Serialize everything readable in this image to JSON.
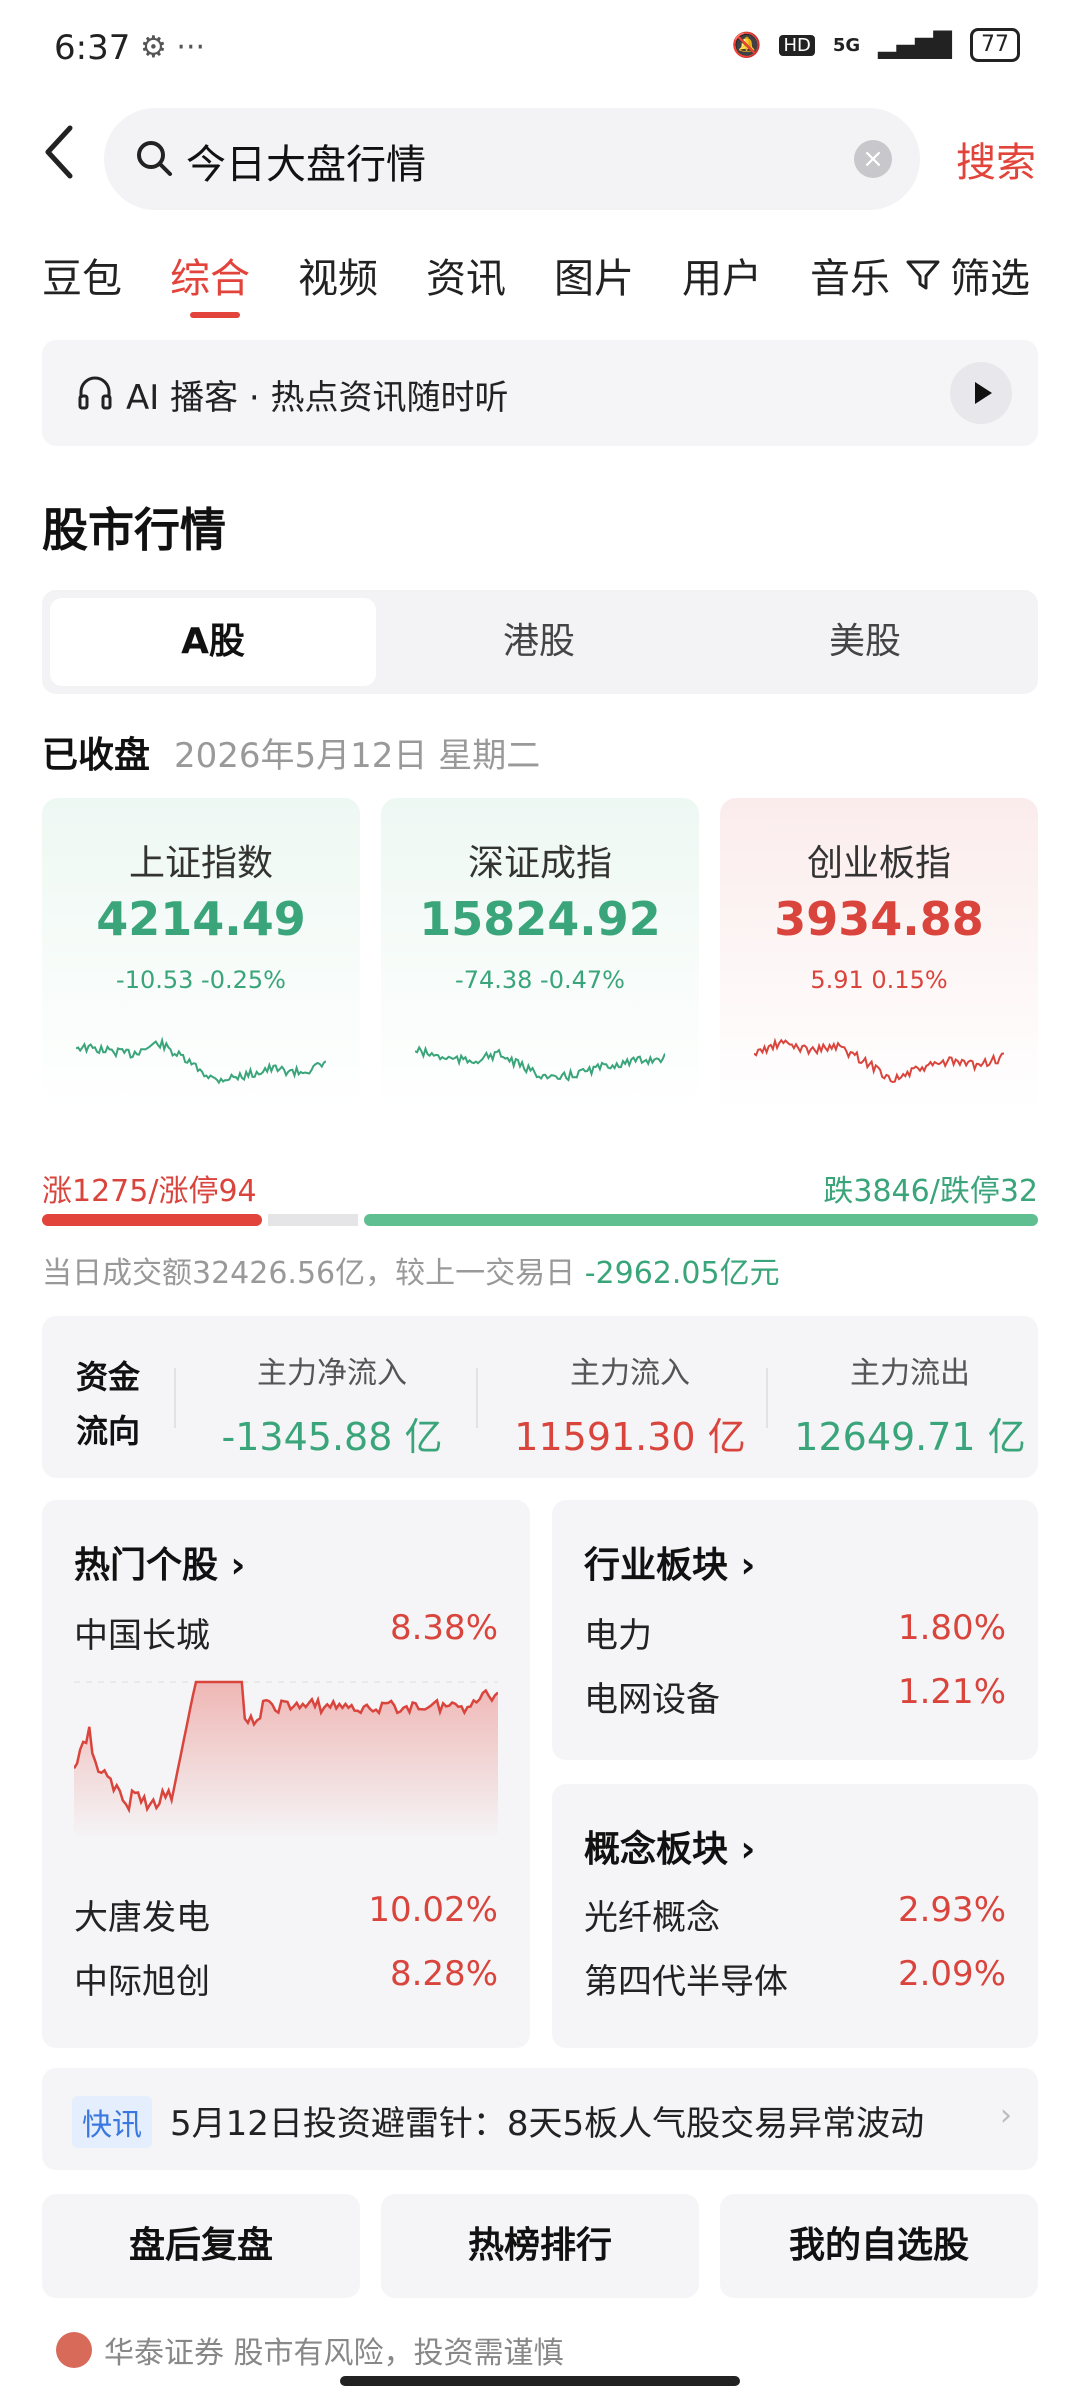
{
  "status_bar": {
    "time": "6:37",
    "network": "5G",
    "hd": "HD",
    "battery": "77"
  },
  "search": {
    "query": "今日大盘行情",
    "button": "搜索"
  },
  "tabs": [
    "豆包",
    "综合",
    "视频",
    "资讯",
    "图片",
    "用户",
    "音乐"
  ],
  "active_tab": "综合",
  "filter_label": "筛选",
  "ai_banner": {
    "text": "AI 播客 · 热点资讯随时听"
  },
  "market": {
    "title": "股市行情",
    "segments": [
      "A股",
      "港股",
      "美股"
    ],
    "active_segment": "A股",
    "status": "已收盘",
    "date": "2026年5月12日 星期二",
    "indices": [
      {
        "name": "上证指数",
        "value": "4214.49",
        "change": "-10.53",
        "pct": "-0.25%",
        "trend": "down"
      },
      {
        "name": "深证成指",
        "value": "15824.92",
        "change": "-74.38",
        "pct": "-0.47%",
        "trend": "down"
      },
      {
        "name": "创业板指",
        "value": "3934.88",
        "change": "5.91",
        "pct": "0.15%",
        "trend": "up"
      }
    ],
    "rise_label": "涨1275/涨停94",
    "fall_label": "跌3846/跌停32",
    "rise_count": 1275,
    "fall_count": 3846,
    "turnover_prefix": "当日成交额32426.56亿，较上一交易日",
    "turnover_delta": "-2962.05亿元"
  },
  "fund_flow": {
    "label_line1": "资金",
    "label_line2": "流向",
    "net_inflow": {
      "label": "主力净流入",
      "value": "-1345.88 亿"
    },
    "inflow": {
      "label": "主力流入",
      "value": "11591.30 亿"
    },
    "outflow": {
      "label": "主力流出",
      "value": "12649.71 亿"
    }
  },
  "hot_stocks": {
    "title": "热门个股 ›",
    "top": {
      "name": "中国长城",
      "pct": "8.38%"
    },
    "rows": [
      {
        "name": "大唐发电",
        "pct": "10.02%"
      },
      {
        "name": "中际旭创",
        "pct": "8.28%"
      }
    ]
  },
  "industry": {
    "title": "行业板块 ›",
    "rows": [
      {
        "name": "电力",
        "pct": "1.80%"
      },
      {
        "name": "电网设备",
        "pct": "1.21%"
      }
    ]
  },
  "concept": {
    "title": "概念板块 ›",
    "rows": [
      {
        "name": "光纤概念",
        "pct": "2.93%"
      },
      {
        "name": "第四代半导体",
        "pct": "2.09%"
      }
    ]
  },
  "news": {
    "tag": "快讯",
    "text": "5月12日投资避雷针：8天5板人气股交易异常波动"
  },
  "quick_buttons": [
    "盘后复盘",
    "热榜排行",
    "我的自选股"
  ],
  "footer": "华泰证券  股市有风险，投资需谨慎",
  "colors": {
    "accent": "#e2433a",
    "up": "#d9453d",
    "down": "#3aa57a"
  }
}
